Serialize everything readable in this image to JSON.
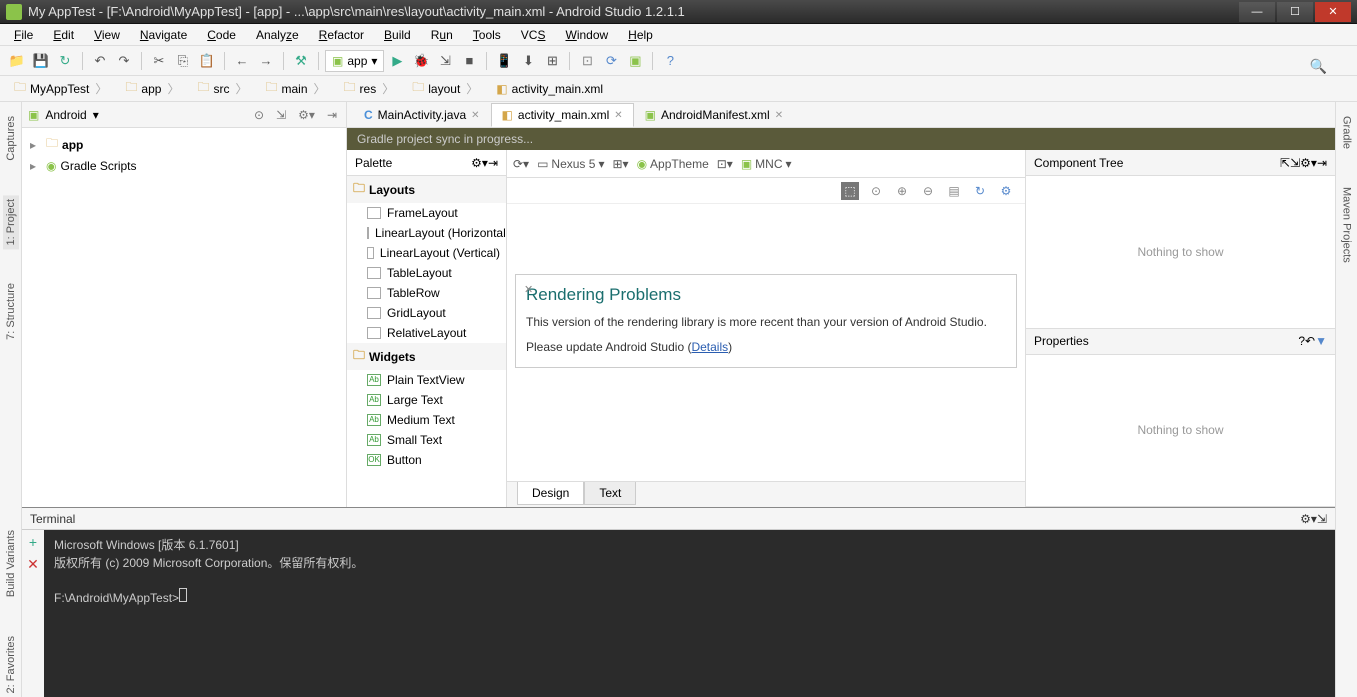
{
  "window": {
    "title": "My AppTest - [F:\\Android\\MyAppTest] - [app] - ...\\app\\src\\main\\res\\layout\\activity_main.xml - Android Studio 1.2.1.1"
  },
  "menu": [
    "File",
    "Edit",
    "View",
    "Navigate",
    "Code",
    "Analyze",
    "Refactor",
    "Build",
    "Run",
    "Tools",
    "VCS",
    "Window",
    "Help"
  ],
  "run_config": "app",
  "breadcrumb": [
    "MyAppTest",
    "app",
    "src",
    "main",
    "res",
    "layout",
    "activity_main.xml"
  ],
  "project": {
    "viewmode": "Android",
    "items": [
      {
        "label": "app",
        "icon": "folder",
        "expandable": true
      },
      {
        "label": "Gradle Scripts",
        "icon": "gradle",
        "expandable": true
      }
    ]
  },
  "editor_tabs": [
    {
      "label": "MainActivity.java",
      "icon": "c",
      "active": false
    },
    {
      "label": "activity_main.xml",
      "icon": "x",
      "active": true
    },
    {
      "label": "AndroidManifest.xml",
      "icon": "a",
      "active": false
    }
  ],
  "sync_message": "Gradle project sync in progress...",
  "palette": {
    "title": "Palette",
    "groups": [
      {
        "name": "Layouts",
        "items": [
          "FrameLayout",
          "LinearLayout (Horizontal)",
          "LinearLayout (Vertical)",
          "TableLayout",
          "TableRow",
          "GridLayout",
          "RelativeLayout"
        ]
      },
      {
        "name": "Widgets",
        "items": [
          "Plain TextView",
          "Large Text",
          "Medium Text",
          "Small Text",
          "Button"
        ]
      }
    ]
  },
  "canvas_toolbar": {
    "device": "Nexus 5",
    "theme": "AppTheme",
    "api": "MNC"
  },
  "rendering": {
    "title": "Rendering Problems",
    "body": "This version of the rendering library is more recent than your version of Android Studio. Please update Android Studio (",
    "link": "Details",
    "body_end": ")"
  },
  "design_tabs": [
    "Design",
    "Text"
  ],
  "component_tree": {
    "title": "Component Tree",
    "empty": "Nothing to show"
  },
  "properties": {
    "title": "Properties",
    "empty": "Nothing to show"
  },
  "terminal": {
    "title": "Terminal",
    "line1": "Microsoft Windows [版本 6.1.7601]",
    "line2": "版权所有 (c) 2009 Microsoft Corporation。保留所有权利。",
    "prompt": "F:\\Android\\MyAppTest>"
  },
  "left_rail": [
    "Captures",
    "1: Project",
    "7: Structure",
    "Build Variants",
    "2: Favorites"
  ],
  "right_rail": [
    "Gradle",
    "Maven Projects"
  ]
}
